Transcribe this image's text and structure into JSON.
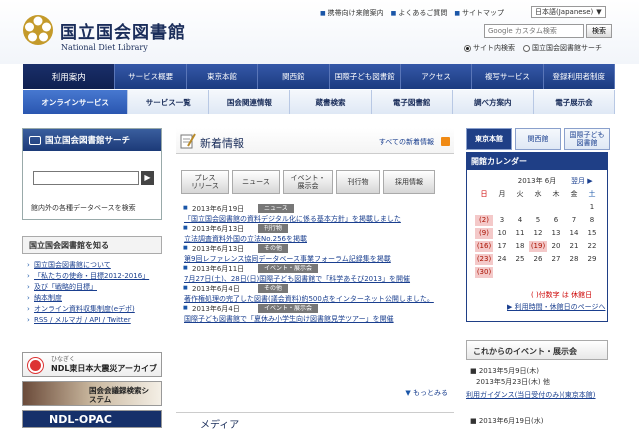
{
  "header": {
    "logo_ja": "国立国会図書館",
    "logo_en": "National Diet Library",
    "util_links": [
      "携帯向け来館案内",
      "よくあるご質問",
      "サイトマップ"
    ],
    "lang_label": "日本語(Japanese)",
    "search_placeholder": "Google カスタム検索",
    "search_button": "検索",
    "radio_site": "サイト内検索",
    "radio_ndl": "国立国会図書館サーチ"
  },
  "nav_primary": [
    "利用案内",
    "サービス概要",
    "東京本館",
    "関西館",
    "国際子ども図書館",
    "アクセス",
    "複写サービス",
    "登録利用者制度"
  ],
  "nav_secondary": [
    "オンラインサービス",
    "サービス一覧",
    "国会関連情報",
    "蔵書検索",
    "電子図書館",
    "調べ方案内",
    "電子展示会"
  ],
  "left": {
    "search_title": "国立国会図書館サーチ",
    "search_go": "▶",
    "search_desc": "館内外の各種データベースを検索",
    "know_title": "国立国会図書館を知る",
    "know_links": [
      "国立国会図書館について",
      "「私たちの使命・目標2012-2016」",
      "及び「戦略的目標」",
      "納本制度",
      "オンライン資料収集制度(eデポ)",
      "RSS / メルマガ / API / Twitter"
    ],
    "banner1": "NDL東日本大震災アーカイブ",
    "banner1_small": "ひなぎく",
    "banner2": "国会会議録検索システム",
    "banner3": "NDL-OPAC"
  },
  "news": {
    "heading": "新着情報",
    "all_link": "すべての新着情報",
    "tabs": [
      "プレス\nリリース",
      "ニュース",
      "イベント・\n展示会",
      "刊行物",
      "採用情報"
    ],
    "items": [
      {
        "date": "2013年6月19日",
        "tag": "ニュース",
        "title": "「国立国会図書館の資料デジタル化に係る基本方針」を掲載しました"
      },
      {
        "date": "2013年6月13日",
        "tag": "刊行物",
        "title": "立法調査資料外国の立法No.256を掲載"
      },
      {
        "date": "2013年6月13日",
        "tag": "その他",
        "title": "第9回レファレンス協同データベース事業フォーラム記録集を掲載"
      },
      {
        "date": "2013年6月11日",
        "tag": "イベント・展示会",
        "title": "7月27日(土)、28日(日)国際子ども図書館で「科学あそび2013」を開催"
      },
      {
        "date": "2013年6月4日",
        "tag": "その他",
        "title": "著作権処理の完了した図書(議会資料)約500点をインターネット公開しました。"
      },
      {
        "date": "2013年6月4日",
        "tag": "イベント・展示会",
        "title": "国際子ども図書館で「夏休み小学生向け図書館見学ツアー」を開催"
      }
    ],
    "more": "もっとみる",
    "section2": "メディア"
  },
  "calendar": {
    "tabs": [
      "東京本館",
      "関西館",
      "国際子ども\n図書館"
    ],
    "title": "開館カレンダー",
    "month_label": "2013年 6月",
    "next_label": "翌月 ▶",
    "weekdays": [
      "日",
      "月",
      "火",
      "水",
      "木",
      "金",
      "土"
    ],
    "days": [
      "",
      "",
      "",
      "",
      "",
      "",
      "1",
      "(2)",
      "3",
      "4",
      "5",
      "6",
      "7",
      "8",
      "(9)",
      "10",
      "11",
      "12",
      "13",
      "14",
      "15",
      "(16)",
      "17",
      "18",
      "(19)",
      "20",
      "21",
      "22",
      "(23)",
      "24",
      "25",
      "26",
      "27",
      "28",
      "29",
      "(30)",
      "",
      "",
      "",
      "",
      "",
      ""
    ],
    "closed": [
      "(2)",
      "(9)",
      "(16)",
      "(19)",
      "(23)",
      "(30)"
    ],
    "legend": "( )付数字 は 休館日",
    "info_link": "▶ 利用時間・休館日のページへ"
  },
  "events": {
    "title": "これからのイベント・展示会",
    "lines": [
      "■ 2013年5月9日(木)",
      "2013年5月23日(木) 他",
      "利用ガイダンス(当日受付のみ)(東京本館)",
      "■ 2013年6月19日(水)"
    ]
  },
  "colors": {
    "nav_dark": "#1f3f86",
    "accent": "#1a56a8",
    "closed": "#f4c9c9"
  }
}
